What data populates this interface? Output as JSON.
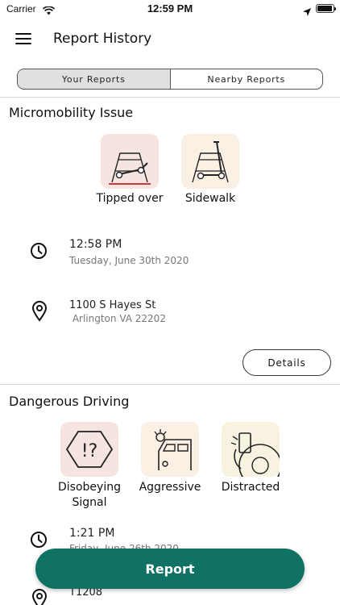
{
  "status_bar": {
    "carrier": "Carrier",
    "time": "12:59 PM",
    "battery_level": 0.95
  },
  "header": {
    "title": "Report History",
    "menu_icon": "hamburger-menu-icon"
  },
  "tabs": [
    {
      "label": "Your Reports",
      "active": true
    },
    {
      "label": "Nearby Reports",
      "active": false
    }
  ],
  "reports": [
    {
      "title": "Micromobility Issue",
      "tags": [
        {
          "label": "Tipped over",
          "icon": "tipped-scooter-icon",
          "bg": "#f5e4df"
        },
        {
          "label": "Sidewalk",
          "icon": "sidewalk-scooter-icon",
          "bg": "#fbf0e4"
        }
      ],
      "time": "12:58 PM",
      "date": "Tuesday, June 30th 2020",
      "address_line1": "1100 S Hayes St",
      "address_line2": " Arlington VA 22202",
      "details_label": "Details"
    },
    {
      "title": "Dangerous Driving",
      "tags": [
        {
          "label": "Disobeying Signal",
          "icon": "warning-hexagon-icon",
          "bg": "#f5e4df"
        },
        {
          "label": "Aggressive",
          "icon": "aggressive-driver-icon",
          "bg": "#fbf0e4"
        },
        {
          "label": "Distracted",
          "icon": "phone-steering-icon",
          "bg": "#f7f3e0"
        }
      ],
      "time": "1:21 PM",
      "date": "Friday, June 26th 2020",
      "address_line1": "T1208"
    }
  ],
  "report_button": {
    "label": "Report"
  },
  "colors": {
    "accent": "#0f7265"
  }
}
